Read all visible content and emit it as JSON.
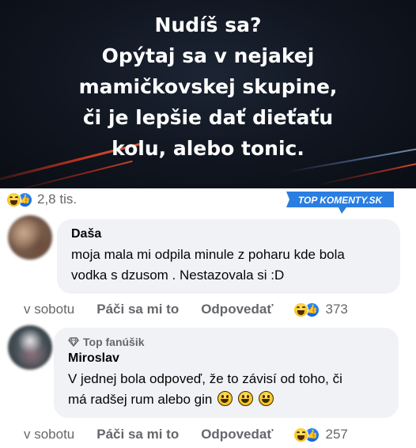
{
  "banner": {
    "lines": [
      "Nudíš sa?",
      "Opýtaj sa v nejakej",
      "mamičkovskej skupine,",
      "či je lepšie dať dieťaťu",
      "kolu, alebo tonic."
    ]
  },
  "post_reactions": {
    "icons": [
      "haha-icon",
      "like-icon"
    ],
    "count": "2,8 tis."
  },
  "logo": {
    "text": "TOP KOMENTY.SK",
    "color": "#2a7de1"
  },
  "comments": [
    {
      "author": "Daša",
      "badge": "",
      "text_lines": [
        "moja mala mi odpila minule z poharu kde bola",
        "vodka s dzusom . Nestazovala si :D"
      ],
      "time": "v sobotu",
      "like_label": "Páči sa mi to",
      "reply_label": "Odpovedať",
      "reaction_count": "373"
    },
    {
      "author": "Miroslav",
      "badge": "Top fanúšik",
      "text_lines": [
        "V jednej bola odpoveď, že to závisí od toho, či",
        "má radšej rum alebo gin"
      ],
      "emojis": [
        "grinning-face-icon",
        "grinning-face-icon",
        "grinning-face-icon"
      ],
      "time": "v sobotu",
      "like_label": "Páči sa mi to",
      "reply_label": "Odpovedať",
      "reaction_count": "257"
    }
  ],
  "colors": {
    "bubble": "#f0f2f5",
    "secondary_text": "#65676b",
    "like_blue": "#1877f2",
    "haha_yellow": "#f7c21b"
  }
}
